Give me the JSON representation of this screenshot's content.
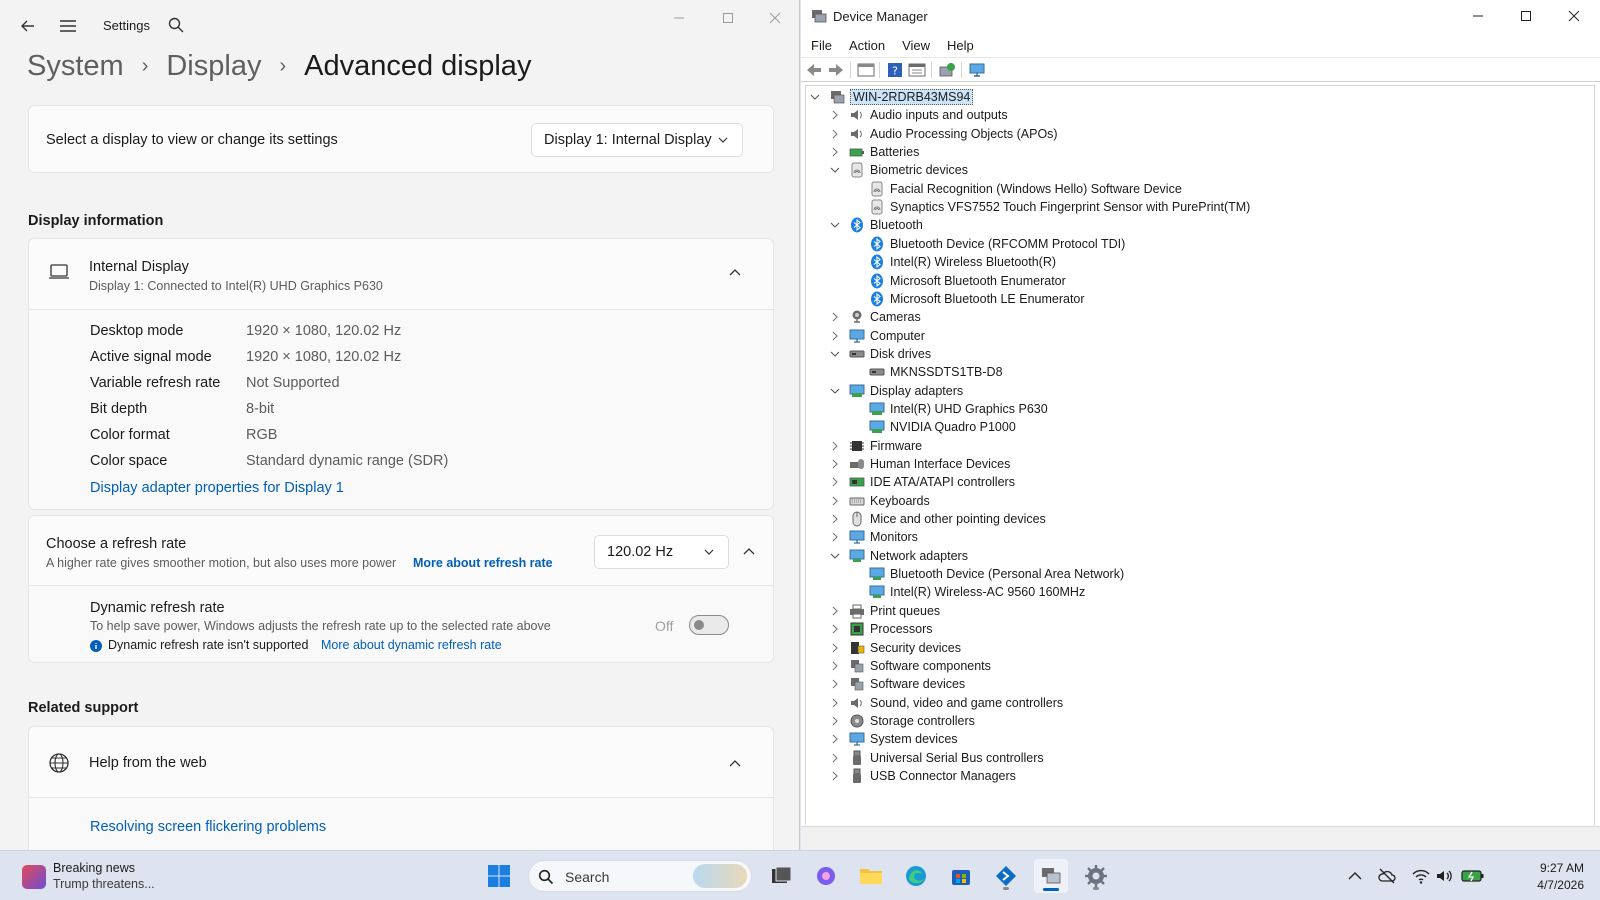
{
  "settings": {
    "app_title": "Settings",
    "breadcrumb": [
      "System",
      "Display",
      "Advanced display"
    ],
    "select_display_label": "Select a display to view or change its settings",
    "select_display_value": "Display 1: Internal Display",
    "display_info_heading": "Display information",
    "display_name": "Internal Display",
    "display_subtitle": "Display 1: Connected to Intel(R) UHD Graphics P630",
    "info": [
      {
        "label": "Desktop mode",
        "value": "1920 × 1080, 120.02 Hz"
      },
      {
        "label": "Active signal mode",
        "value": "1920 × 1080, 120.02 Hz"
      },
      {
        "label": "Variable refresh rate",
        "value": "Not Supported"
      },
      {
        "label": "Bit depth",
        "value": "8-bit"
      },
      {
        "label": "Color format",
        "value": "RGB"
      },
      {
        "label": "Color space",
        "value": "Standard dynamic range (SDR)"
      }
    ],
    "adapter_link": "Display adapter properties for Display 1",
    "refresh_title": "Choose a refresh rate",
    "refresh_desc": "A higher rate gives smoother motion, but also uses more power",
    "refresh_link": "More about refresh rate",
    "refresh_value": "120.02 Hz",
    "dynamic_title": "Dynamic refresh rate",
    "dynamic_desc": "To help save power, Windows adjusts the refresh rate up to the selected rate above",
    "dynamic_note": "Dynamic refresh rate isn't supported",
    "dynamic_link": "More about dynamic refresh rate",
    "dynamic_state": "Off",
    "related_heading": "Related support",
    "help_title": "Help from the web",
    "help_link": "Resolving screen flickering problems"
  },
  "devmgr": {
    "title": "Device Manager",
    "menu": [
      "File",
      "Action",
      "View",
      "Help"
    ],
    "root": "WIN-2RDRB43MS94",
    "tree": [
      {
        "label": "Audio inputs and outputs",
        "level": 1,
        "state": "collapsed",
        "icon": "speaker-icon"
      },
      {
        "label": "Audio Processing Objects (APOs)",
        "level": 1,
        "state": "collapsed",
        "icon": "speaker-icon"
      },
      {
        "label": "Batteries",
        "level": 1,
        "state": "collapsed",
        "icon": "battery-icon"
      },
      {
        "label": "Biometric devices",
        "level": 1,
        "state": "expanded",
        "icon": "fingerprint-icon"
      },
      {
        "label": "Facial Recognition (Windows Hello) Software Device",
        "level": 2,
        "icon": "fingerprint-icon"
      },
      {
        "label": "Synaptics VFS7552 Touch Fingerprint Sensor with PurePrint(TM)",
        "level": 2,
        "icon": "fingerprint-icon"
      },
      {
        "label": "Bluetooth",
        "level": 1,
        "state": "expanded",
        "icon": "bluetooth-icon"
      },
      {
        "label": "Bluetooth Device (RFCOMM Protocol TDI)",
        "level": 2,
        "icon": "bluetooth-icon"
      },
      {
        "label": "Intel(R) Wireless Bluetooth(R)",
        "level": 2,
        "icon": "bluetooth-icon"
      },
      {
        "label": "Microsoft Bluetooth Enumerator",
        "level": 2,
        "icon": "bluetooth-icon"
      },
      {
        "label": "Microsoft Bluetooth LE Enumerator",
        "level": 2,
        "icon": "bluetooth-icon"
      },
      {
        "label": "Cameras",
        "level": 1,
        "state": "collapsed",
        "icon": "camera-icon"
      },
      {
        "label": "Computer",
        "level": 1,
        "state": "collapsed",
        "icon": "monitor-icon"
      },
      {
        "label": "Disk drives",
        "level": 1,
        "state": "expanded",
        "icon": "disk-icon"
      },
      {
        "label": "MKNSSDTS1TB-D8",
        "level": 2,
        "icon": "disk-icon"
      },
      {
        "label": "Display adapters",
        "level": 1,
        "state": "expanded",
        "icon": "display-adapter-icon"
      },
      {
        "label": "Intel(R) UHD Graphics P630",
        "level": 2,
        "icon": "display-adapter-icon"
      },
      {
        "label": "NVIDIA Quadro P1000",
        "level": 2,
        "icon": "display-adapter-icon"
      },
      {
        "label": "Firmware",
        "level": 1,
        "state": "collapsed",
        "icon": "chip-icon"
      },
      {
        "label": "Human Interface Devices",
        "level": 1,
        "state": "collapsed",
        "icon": "hid-icon"
      },
      {
        "label": "IDE ATA/ATAPI controllers",
        "level": 1,
        "state": "collapsed",
        "icon": "controller-icon"
      },
      {
        "label": "Keyboards",
        "level": 1,
        "state": "collapsed",
        "icon": "keyboard-icon"
      },
      {
        "label": "Mice and other pointing devices",
        "level": 1,
        "state": "collapsed",
        "icon": "mouse-icon"
      },
      {
        "label": "Monitors",
        "level": 1,
        "state": "collapsed",
        "icon": "monitor-icon"
      },
      {
        "label": "Network adapters",
        "level": 1,
        "state": "expanded",
        "icon": "network-icon"
      },
      {
        "label": "Bluetooth Device (Personal Area Network)",
        "level": 2,
        "icon": "network-icon"
      },
      {
        "label": "Intel(R) Wireless-AC 9560 160MHz",
        "level": 2,
        "icon": "network-icon"
      },
      {
        "label": "Print queues",
        "level": 1,
        "state": "collapsed",
        "icon": "printer-icon"
      },
      {
        "label": "Processors",
        "level": 1,
        "state": "collapsed",
        "icon": "processor-icon"
      },
      {
        "label": "Security devices",
        "level": 1,
        "state": "collapsed",
        "icon": "security-icon"
      },
      {
        "label": "Software components",
        "level": 1,
        "state": "collapsed",
        "icon": "component-icon"
      },
      {
        "label": "Software devices",
        "level": 1,
        "state": "collapsed",
        "icon": "component-icon"
      },
      {
        "label": "Sound, video and game controllers",
        "level": 1,
        "state": "collapsed",
        "icon": "speaker-icon"
      },
      {
        "label": "Storage controllers",
        "level": 1,
        "state": "collapsed",
        "icon": "storage-icon"
      },
      {
        "label": "System devices",
        "level": 1,
        "state": "collapsed",
        "icon": "monitor-icon"
      },
      {
        "label": "Universal Serial Bus controllers",
        "level": 1,
        "state": "collapsed",
        "icon": "usb-icon"
      },
      {
        "label": "USB Connector Managers",
        "level": 1,
        "state": "collapsed",
        "icon": "usb-icon"
      }
    ]
  },
  "taskbar": {
    "news_title": "Breaking news",
    "news_sub": "Trump threatens...",
    "search_placeholder": "Search",
    "time": "9:27 AM",
    "date": "4/7/2026"
  },
  "colors": {
    "accent": "#005fb8",
    "settings_bg": "#f3f3f3",
    "tree_selection": "#cce4f7"
  }
}
